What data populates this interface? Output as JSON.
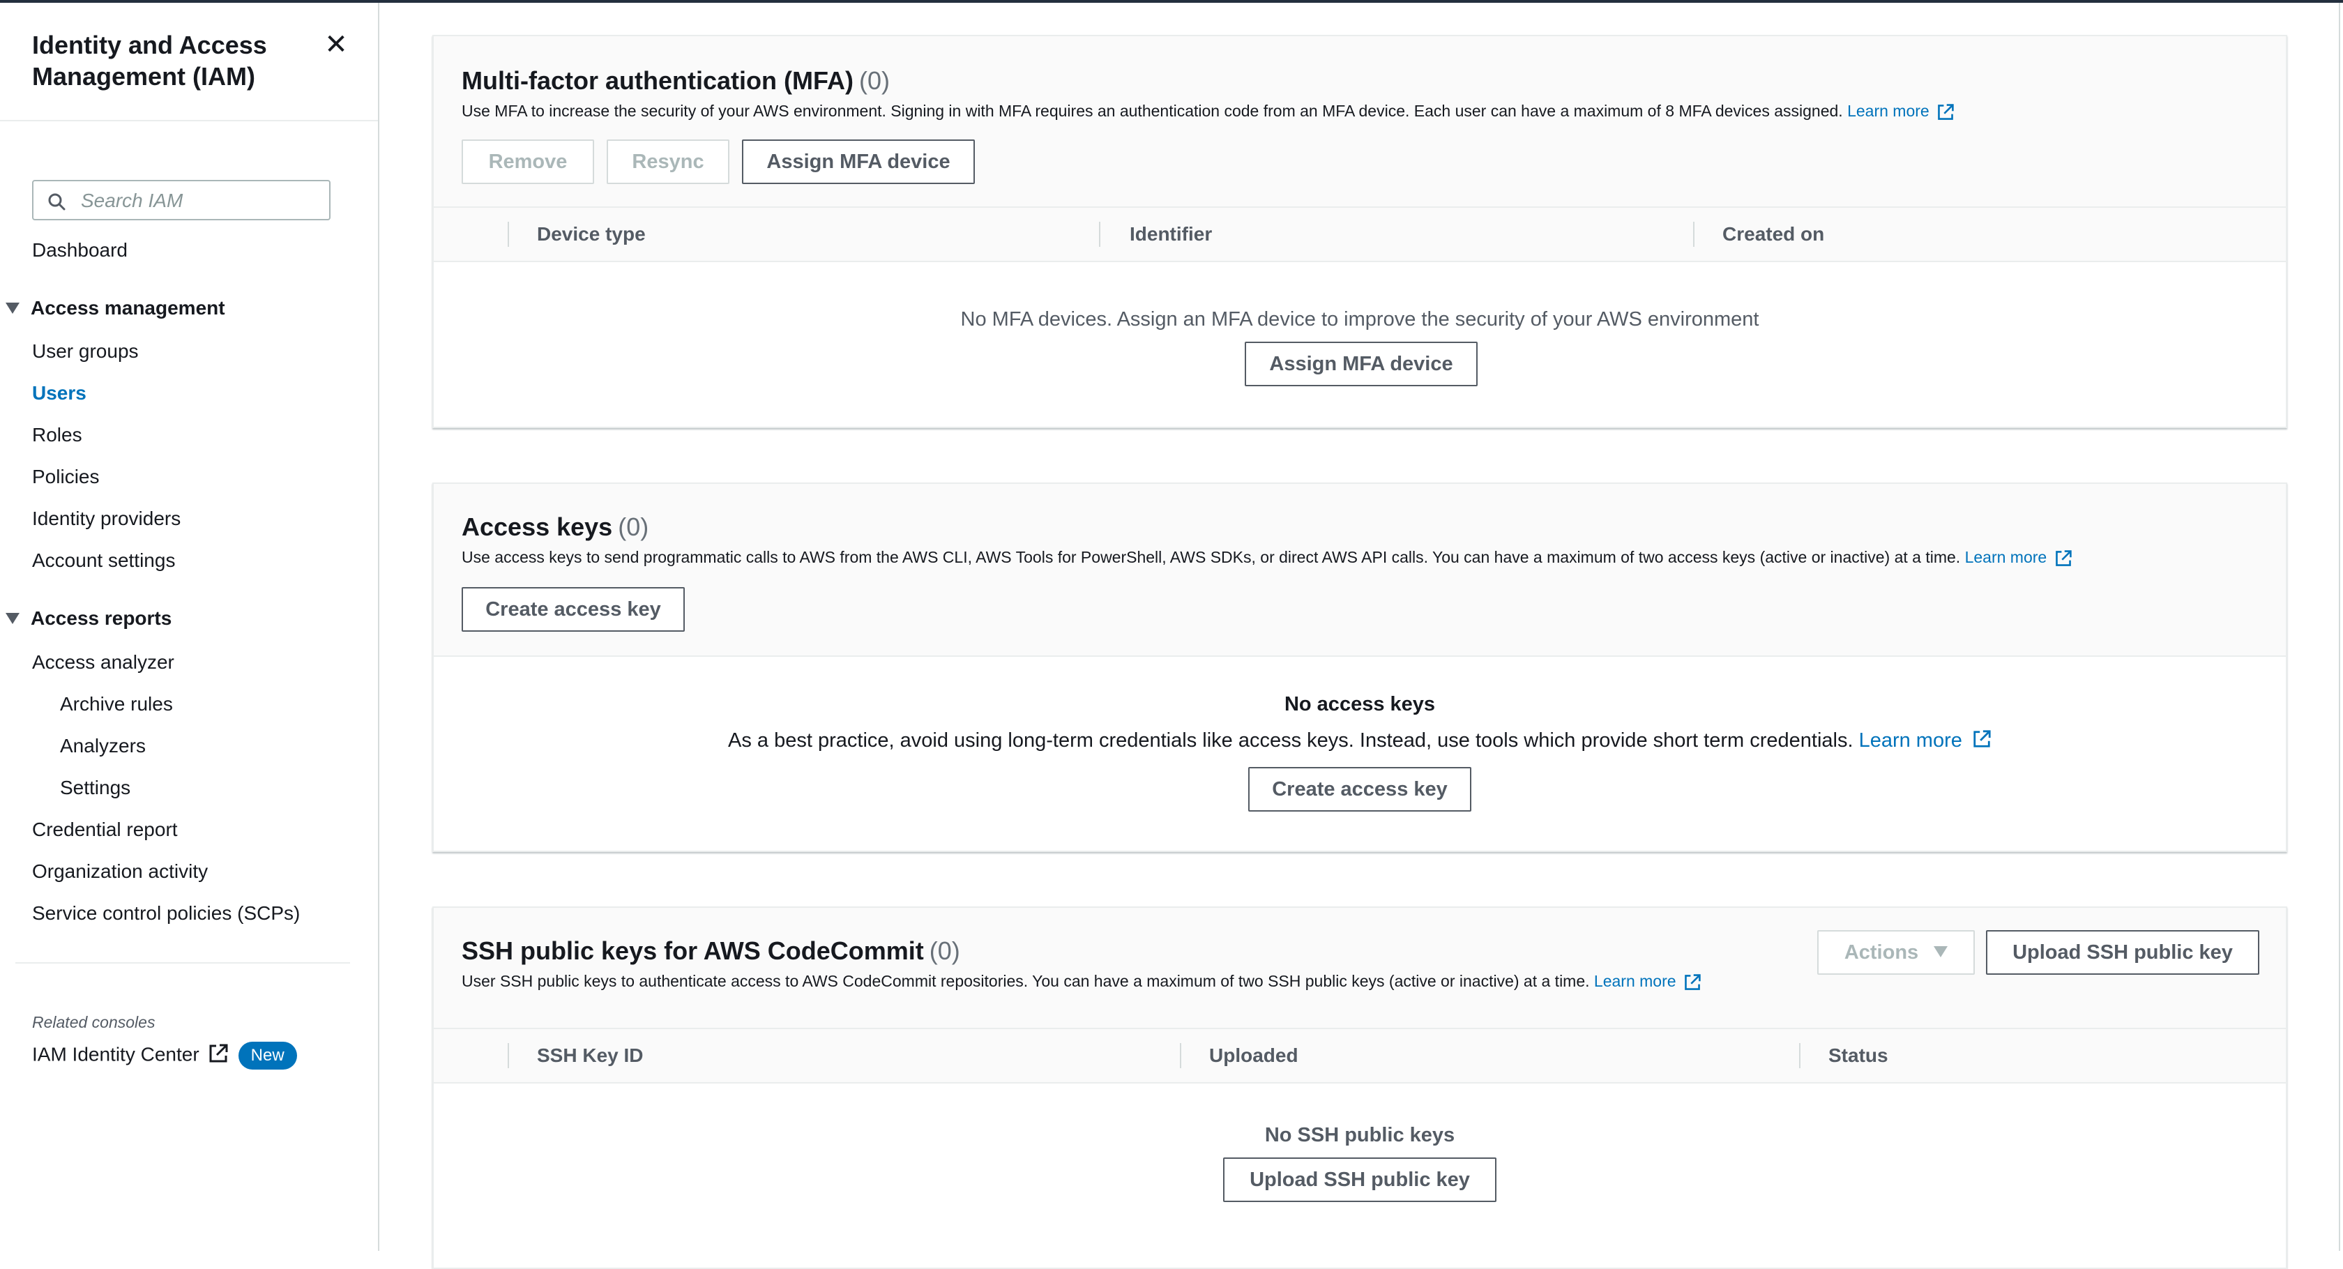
{
  "sidebar": {
    "title": "Identity and Access Management (IAM)",
    "close_icon": "close-icon",
    "search": {
      "placeholder": "Search IAM",
      "value": ""
    },
    "dashboard": "Dashboard",
    "access_management": {
      "label": "Access management",
      "items": [
        "User groups",
        "Users",
        "Roles",
        "Policies",
        "Identity providers",
        "Account settings"
      ],
      "active": "Users"
    },
    "access_reports": {
      "label": "Access reports",
      "items": {
        "access_analyzer": "Access analyzer",
        "archive_rules": "Archive rules",
        "analyzers": "Analyzers",
        "settings": "Settings",
        "credential_report": "Credential report",
        "organization_activity": "Organization activity",
        "scps": "Service control policies (SCPs)"
      }
    },
    "related_consoles": {
      "label": "Related consoles",
      "item": "IAM Identity Center",
      "badge": "New"
    }
  },
  "mfa": {
    "title": "Multi-factor authentication (MFA)",
    "count": "(0)",
    "description": "Use MFA to increase the security of your AWS environment. Signing in with MFA requires an authentication code from an MFA device. Each user can have a maximum of 8 MFA devices assigned.",
    "learn_more": "Learn more",
    "buttons": {
      "remove": "Remove",
      "resync": "Resync",
      "assign": "Assign MFA device"
    },
    "columns": [
      "Device type",
      "Identifier",
      "Created on"
    ],
    "empty_message": "No MFA devices. Assign an MFA device to improve the security of your AWS environment",
    "empty_button": "Assign MFA device"
  },
  "access_keys": {
    "title": "Access keys",
    "count": "(0)",
    "description": "Use access keys to send programmatic calls to AWS from the AWS CLI, AWS Tools for PowerShell, AWS SDKs, or direct AWS API calls. You can have a maximum of two access keys (active or inactive) at a time.",
    "learn_more": "Learn more",
    "create_button": "Create access key",
    "empty_title": "No access keys",
    "empty_message": "As a best practice, avoid using long-term credentials like access keys. Instead, use tools which provide short term credentials.",
    "empty_learn_more": "Learn more",
    "empty_button": "Create access key"
  },
  "ssh_keys": {
    "title": "SSH public keys for AWS CodeCommit",
    "count": "(0)",
    "description": "User SSH public keys to authenticate access to AWS CodeCommit repositories. You can have a maximum of two SSH public keys (active or inactive) at a time.",
    "learn_more": "Learn more",
    "actions_button": "Actions",
    "upload_button": "Upload SSH public key",
    "columns": [
      "SSH Key ID",
      "Uploaded",
      "Status"
    ],
    "empty_title": "No SSH public keys",
    "empty_button": "Upload SSH public key"
  },
  "colors": {
    "link": "#0073bb",
    "text": "#16191f",
    "muted": "#545b64",
    "badge": "#0073bb"
  }
}
